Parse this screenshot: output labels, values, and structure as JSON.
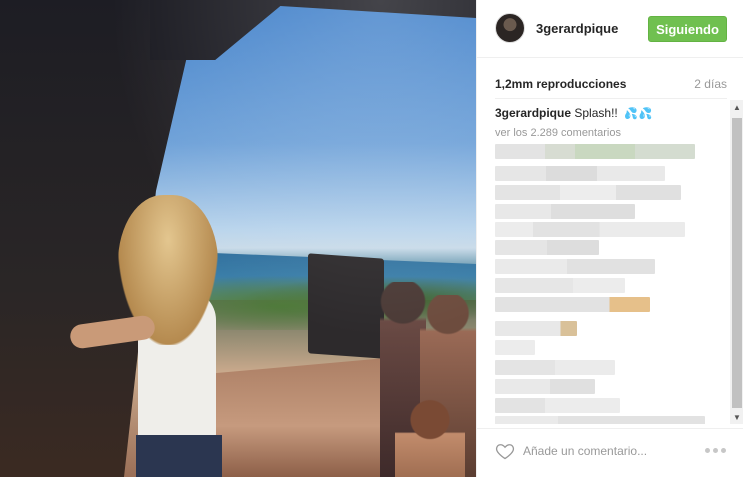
{
  "post": {
    "username": "3gerardpique",
    "follow_label": "Siguiendo",
    "views": "1,2mm reproducciones",
    "time_ago": "2 días"
  },
  "caption": {
    "username": "3gerardpique",
    "text": "Splash!!",
    "emoji": "💦💦"
  },
  "comments": {
    "view_all": "ver los 2.289 comentarios"
  },
  "composer": {
    "placeholder": "Añade un comentario..."
  },
  "icons": {
    "avatar": "avatar",
    "like": "heart-icon",
    "more": "more-options-icon",
    "scroll_up": "scroll-up-arrow",
    "scroll_down": "scroll-down-arrow"
  },
  "colors": {
    "follow_button": "#70c050",
    "muted_text": "#999999",
    "divider": "#efefef"
  }
}
